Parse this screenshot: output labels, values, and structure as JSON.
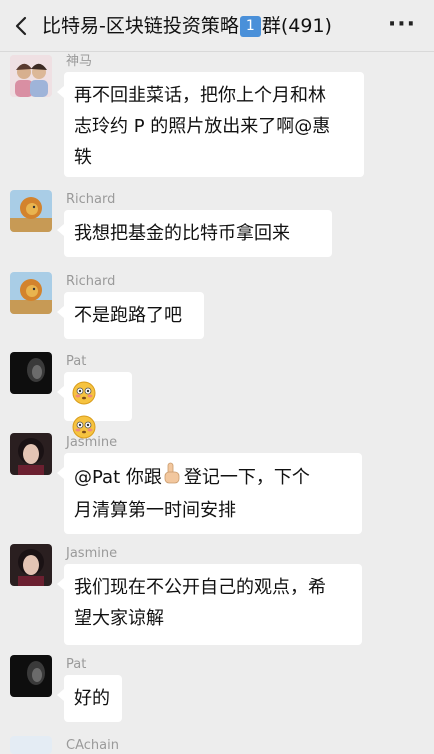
{
  "header": {
    "title_part1": "比特易-区块链投资策略",
    "badge": "1",
    "title_part2": "群(491)",
    "back_icon": "chevron-left-icon",
    "more_label": "···"
  },
  "messages": [
    {
      "sender": "神马",
      "lines": [
        "再不回韭菜话，把你上个月和林",
        "志玲约 P 的照片放出来了啊@惠",
        "轶"
      ]
    },
    {
      "sender": "Richard",
      "lines": [
        "我想把基金的比特币拿回来"
      ]
    },
    {
      "sender": "Richard",
      "lines": [
        "不是跑路了吧"
      ]
    },
    {
      "sender": "Pat",
      "emojis": [
        "flushed-face-emoji",
        "flushed-face-emoji"
      ]
    },
    {
      "sender": "Jasmine",
      "line1_a": "@Pat 你跟",
      "line1_emoji": "pointing-finger-emoji",
      "line1_b": "登记一下，下个",
      "line2": "月清算第一时间安排"
    },
    {
      "sender": "Jasmine",
      "lines": [
        "我们现在不公开自己的观点，希",
        "望大家谅解"
      ]
    },
    {
      "sender": "Pat",
      "lines": [
        "好的"
      ]
    },
    {
      "sender": "CAchain"
    }
  ],
  "colors": {
    "background": "#ededed",
    "bubble": "#ffffff",
    "badge": "#4a90d9",
    "sender_name": "#9a9a9a"
  }
}
